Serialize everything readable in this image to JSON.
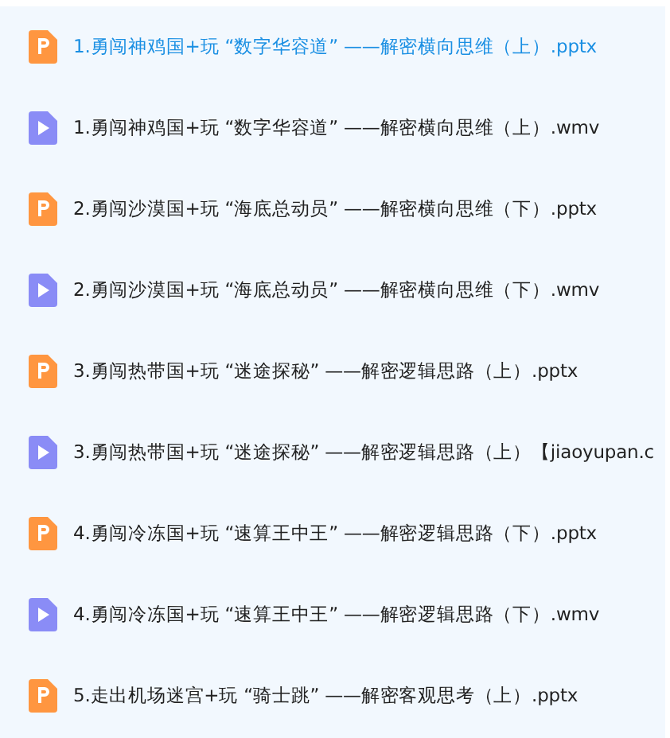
{
  "files": [
    {
      "kind": "pptx",
      "name": "1.勇闯神鸡国+玩 “数字华容道” ——解密横向思维（上）.pptx",
      "selected": true
    },
    {
      "kind": "wmv",
      "name": "1.勇闯神鸡国+玩 “数字华容道” ——解密横向思维（上）.wmv",
      "selected": false
    },
    {
      "kind": "pptx",
      "name": "2.勇闯沙漠国+玩 “海底总动员” ——解密横向思维（下）.pptx",
      "selected": false
    },
    {
      "kind": "wmv",
      "name": "2.勇闯沙漠国+玩 “海底总动员” ——解密横向思维（下）.wmv",
      "selected": false
    },
    {
      "kind": "pptx",
      "name": "3.勇闯热带国+玩 “迷途探秘” ——解密逻辑思路（上）.pptx",
      "selected": false
    },
    {
      "kind": "wmv",
      "name": "3.勇闯热带国+玩 “迷途探秘” ——解密逻辑思路（上）【jiaoyupan.c",
      "selected": false
    },
    {
      "kind": "pptx",
      "name": "4.勇闯冷冻国+玩 “速算王中王” ——解密逻辑思路（下）.pptx",
      "selected": false
    },
    {
      "kind": "wmv",
      "name": "4.勇闯冷冻国+玩 “速算王中王” ——解密逻辑思路（下）.wmv",
      "selected": false
    },
    {
      "kind": "pptx",
      "name": "5.走出机场迷宫+玩 “骑士跳” ——解密客观思考（上）.pptx",
      "selected": false
    }
  ]
}
